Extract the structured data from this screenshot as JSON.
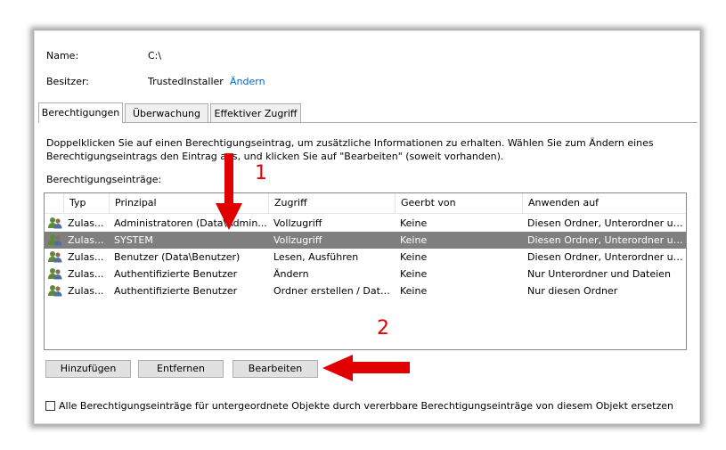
{
  "header": {
    "name_label": "Name:",
    "name_value": "C:\\",
    "owner_label": "Besitzer:",
    "owner_value": "TrustedInstaller",
    "change_link": "Ändern"
  },
  "tabs": [
    {
      "label": "Berechtigungen",
      "active": true
    },
    {
      "label": "Überwachung",
      "active": false
    },
    {
      "label": "Effektiver Zugriff",
      "active": false
    }
  ],
  "description": "Doppelklicken Sie auf einen Berechtigungseintrag, um zusätzliche Informationen zu erhalten. Wählen Sie zum Ändern eines Berechtigungseintrags den Eintrag aus, und klicken Sie auf \"Bearbeiten\" (soweit vorhanden).",
  "entries_label": "Berechtigungseinträge:",
  "table": {
    "columns": [
      "Typ",
      "Prinzipal",
      "Zugriff",
      "Geerbt von",
      "Anwenden auf"
    ],
    "rows": [
      {
        "typ": "Zulas...",
        "prinzipal": "Administratoren (Data\\Admin...",
        "zugriff": "Vollzugriff",
        "geerbt": "Keine",
        "anwenden": "Diesen Ordner, Unterordner un...",
        "selected": false
      },
      {
        "typ": "Zulas...",
        "prinzipal": "SYSTEM",
        "zugriff": "Vollzugriff",
        "geerbt": "Keine",
        "anwenden": "Diesen Ordner, Unterordner un...",
        "selected": true
      },
      {
        "typ": "Zulas...",
        "prinzipal": "Benutzer (Data\\Benutzer)",
        "zugriff": "Lesen, Ausführen",
        "geerbt": "Keine",
        "anwenden": "Diesen Ordner, Unterordner un...",
        "selected": false
      },
      {
        "typ": "Zulas...",
        "prinzipal": "Authentifizierte Benutzer",
        "zugriff": "Ändern",
        "geerbt": "Keine",
        "anwenden": "Nur Unterordner und Dateien",
        "selected": false
      },
      {
        "typ": "Zulas...",
        "prinzipal": "Authentifizierte Benutzer",
        "zugriff": "Ordner erstellen / Date...",
        "geerbt": "Keine",
        "anwenden": "Nur diesen Ordner",
        "selected": false
      }
    ]
  },
  "buttons": {
    "add": "Hinzufügen",
    "remove": "Entfernen",
    "edit": "Bearbeiten"
  },
  "checkbox_label": "Alle Berechtigungseinträge für untergeordnete Objekte durch vererbbare Berechtigungseinträge von diesem Objekt ersetzen",
  "annotations": {
    "marker1": "1",
    "marker2": "2"
  },
  "colors": {
    "link": "#0066cc",
    "selection": "#7f7f7f",
    "arrow": "#e00000"
  },
  "icons": {
    "user_group": "users-group-icon"
  }
}
